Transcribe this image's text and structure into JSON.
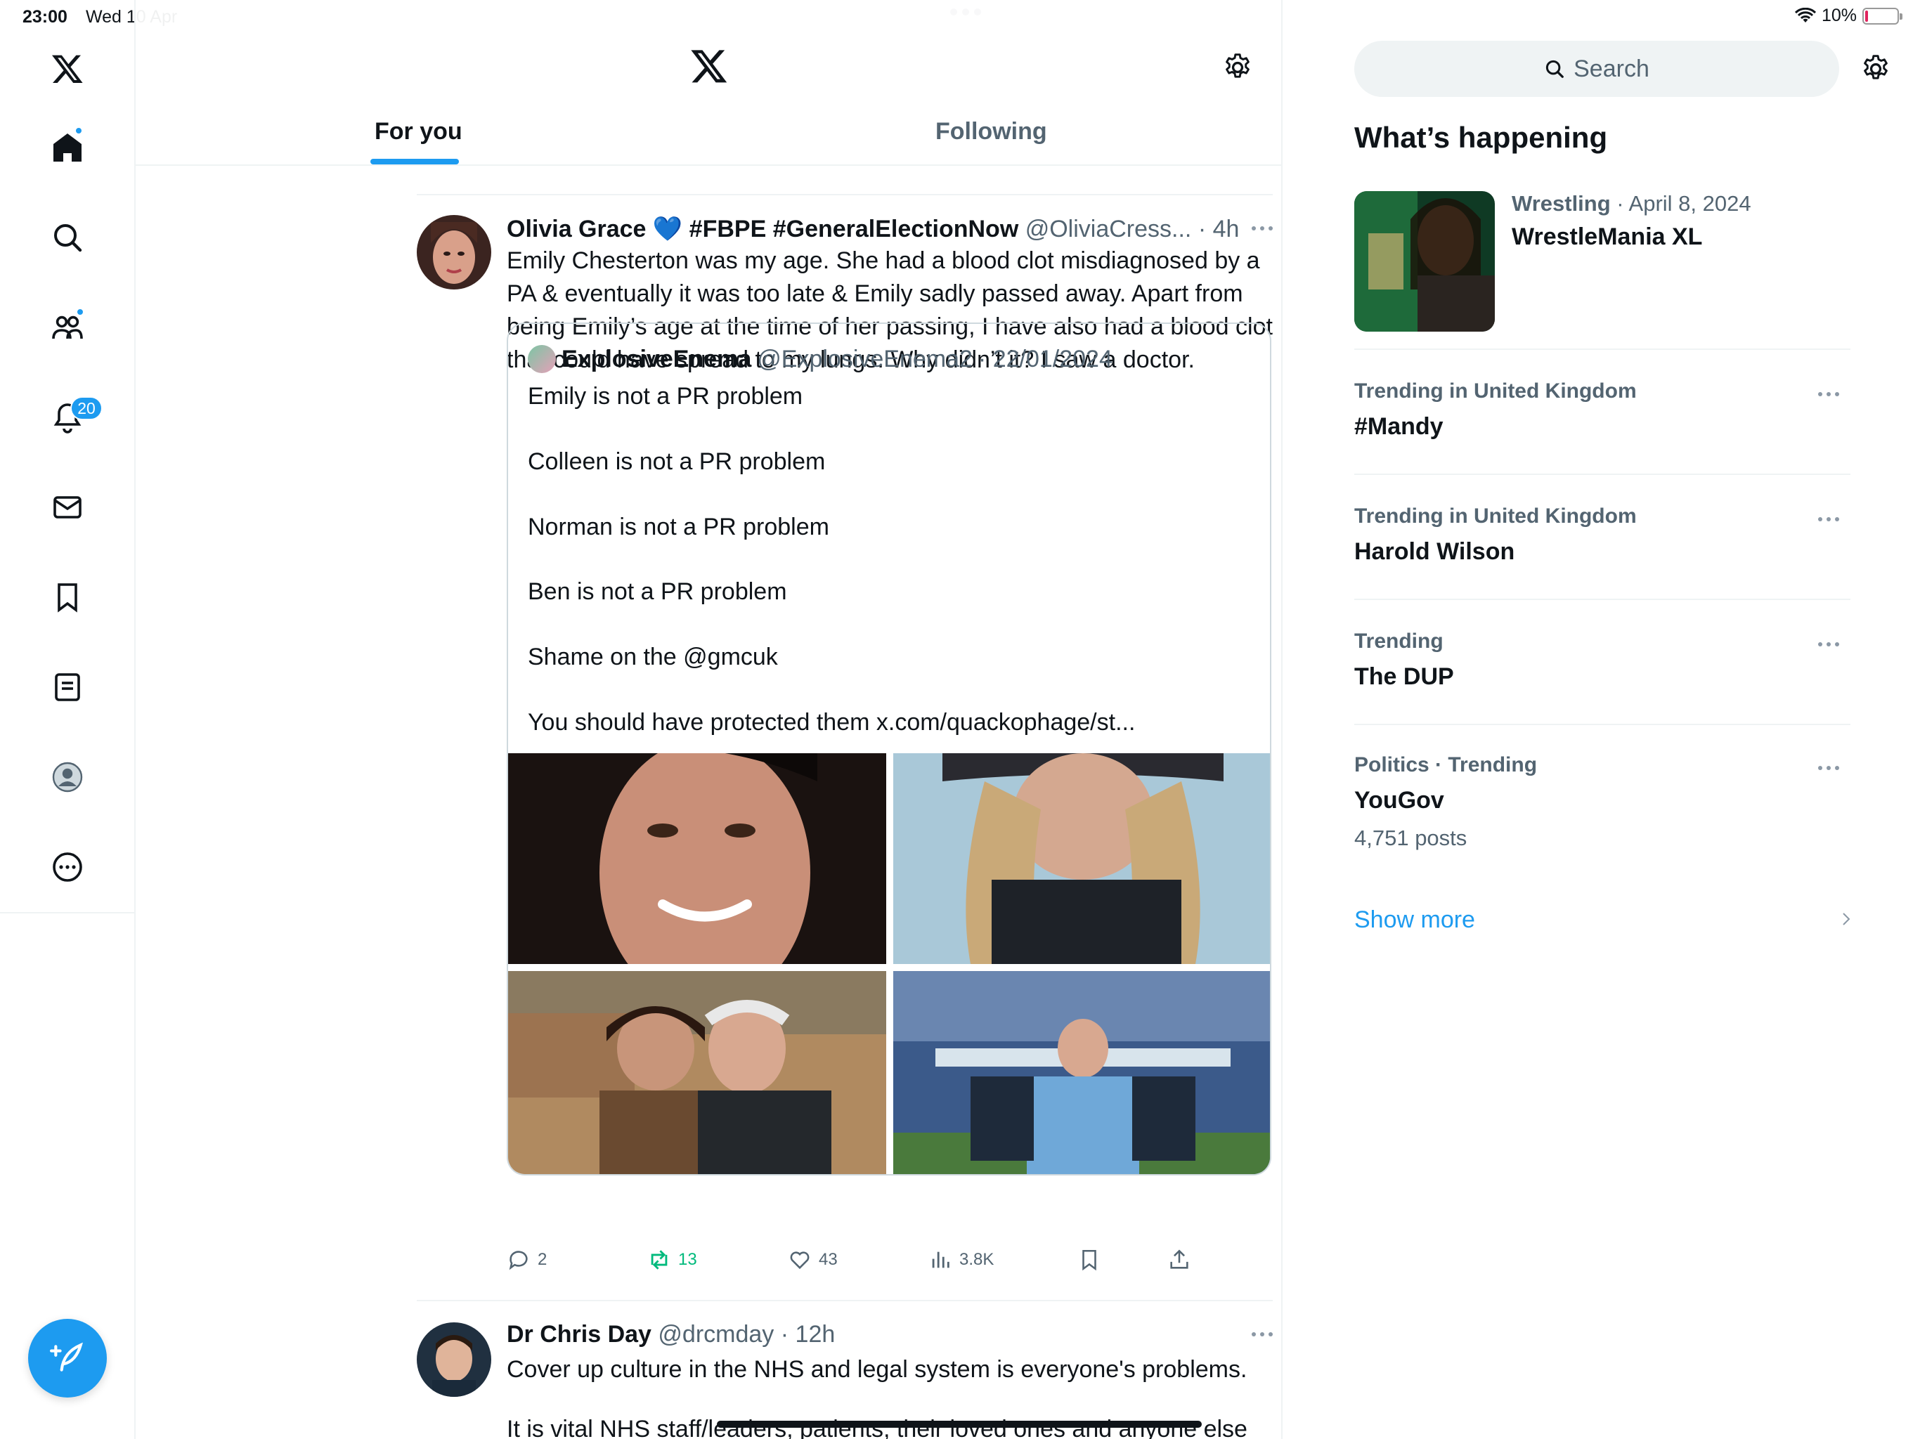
{
  "status_bar": {
    "time": "23:00",
    "date": "Wed 10 Apr",
    "battery": "10%",
    "battery_level": 0.1
  },
  "nav": {
    "items": [
      {
        "name": "home-icon",
        "active": true,
        "badge_dot": true
      },
      {
        "name": "search-icon"
      },
      {
        "name": "communities-icon",
        "badge_dot": true
      },
      {
        "name": "bell-icon",
        "badge": "20"
      },
      {
        "name": "mail-icon"
      },
      {
        "name": "bookmark-icon"
      },
      {
        "name": "lists-icon"
      },
      {
        "name": "profile-icon"
      },
      {
        "name": "more-circle-icon"
      }
    ],
    "compose_icon": "compose-feather-icon"
  },
  "header": {
    "tabs": [
      {
        "label": "For you",
        "active": true
      },
      {
        "label": "Following",
        "active": false
      }
    ],
    "accent": "#1d9bf0"
  },
  "posts": [
    {
      "name": "Olivia Grace 💙 #FBPE #GeneralElectionNow",
      "handle": "@OliviaCress...",
      "time": "· 4h",
      "text": [
        "Emily Chesterton was my age. She had a blood clot misdiagnosed by a",
        "PA & eventually it was too late & Emily sadly passed away. Apart from",
        "being Emily’s age at the time of her passing, I have also had a blood clot",
        "that could have spread to my lungs. Why didn’t it? I saw a doctor."
      ],
      "quote": {
        "name": "ExplosiveEnema",
        "handle": "@ExplosiveEnema2",
        "date": "· 22/01/2024",
        "lines": [
          "Emily is not a PR problem",
          "Colleen is not a PR problem",
          "Norman is not a PR problem",
          "Ben is not a PR problem",
          "Shame on the @gmcuk",
          "You should have protected them x.com/quackophage/st..."
        ]
      },
      "stats": {
        "replies": "2",
        "reposts": "13",
        "likes": "43",
        "views": "3.8K"
      }
    },
    {
      "name": "Dr Chris Day",
      "handle": "@drcmday",
      "time": "· 12h",
      "text": [
        "Cover up culture in the NHS and legal system is everyone's problems.",
        "It is vital NHS staff/leaders, patients, their loved ones and anyone else"
      ]
    }
  ],
  "sidebar": {
    "search_placeholder": "Search",
    "title": "What’s happening",
    "event": {
      "category": "Wrestling",
      "date": "· April 8, 2024",
      "title": "WrestleMania XL"
    },
    "trends": [
      {
        "meta": "Trending in United Kingdom",
        "title": "#Mandy"
      },
      {
        "meta": "Trending in United Kingdom",
        "title": "Harold Wilson"
      },
      {
        "meta": "Trending",
        "title": "The DUP"
      },
      {
        "meta": "Politics · Trending",
        "title": "YouGov",
        "count": "4,751 posts"
      }
    ],
    "show_more": "Show more"
  }
}
